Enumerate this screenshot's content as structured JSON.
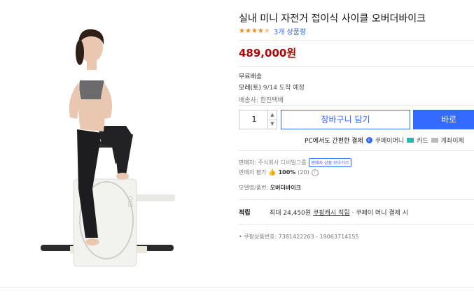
{
  "breadcrumb": "- - · - · - - · - - · · · · ·",
  "product": {
    "title": "실내 미니 자전거 접이식 사이클 오버더바이크",
    "stars": 4.5,
    "review_count": "3개 상품평",
    "price": "489,000원",
    "image_brand_text": "OtB"
  },
  "shipping": {
    "type": "무료배송",
    "arrival_prefix": "모레(토)",
    "arrival_suffix": "9/14 도착 예정",
    "carrier": "배송사: 한진택배"
  },
  "purchase": {
    "quantity": "1",
    "cart_label": "장바구니 담기",
    "buy_label": "바로"
  },
  "payment": {
    "label": "PC에서도 간편한 결제",
    "coupay": "쿠페이머니",
    "card": "카드",
    "account": "계좌이체"
  },
  "seller": {
    "label": "판매자:",
    "name": "주식회사 디비빌그룹",
    "button": "판매자 상품 모아가기",
    "rating_label": "판매자 평가",
    "rating_value": "100%",
    "rating_count": "(20)"
  },
  "model": {
    "label": "모델명/품번:",
    "value": "오버더바이크"
  },
  "reward": {
    "head": "적립",
    "prefix": "최대 24,450원",
    "link": "쿠팡캐시 적립",
    "suffix": "· 쿠페이 머니 결제 시"
  },
  "product_id": "쿠팡상품번호: 7381422263 - 19063714155",
  "colors": {
    "accent": "#346aff",
    "price": "#ae0000",
    "star": "#f28b1e"
  }
}
